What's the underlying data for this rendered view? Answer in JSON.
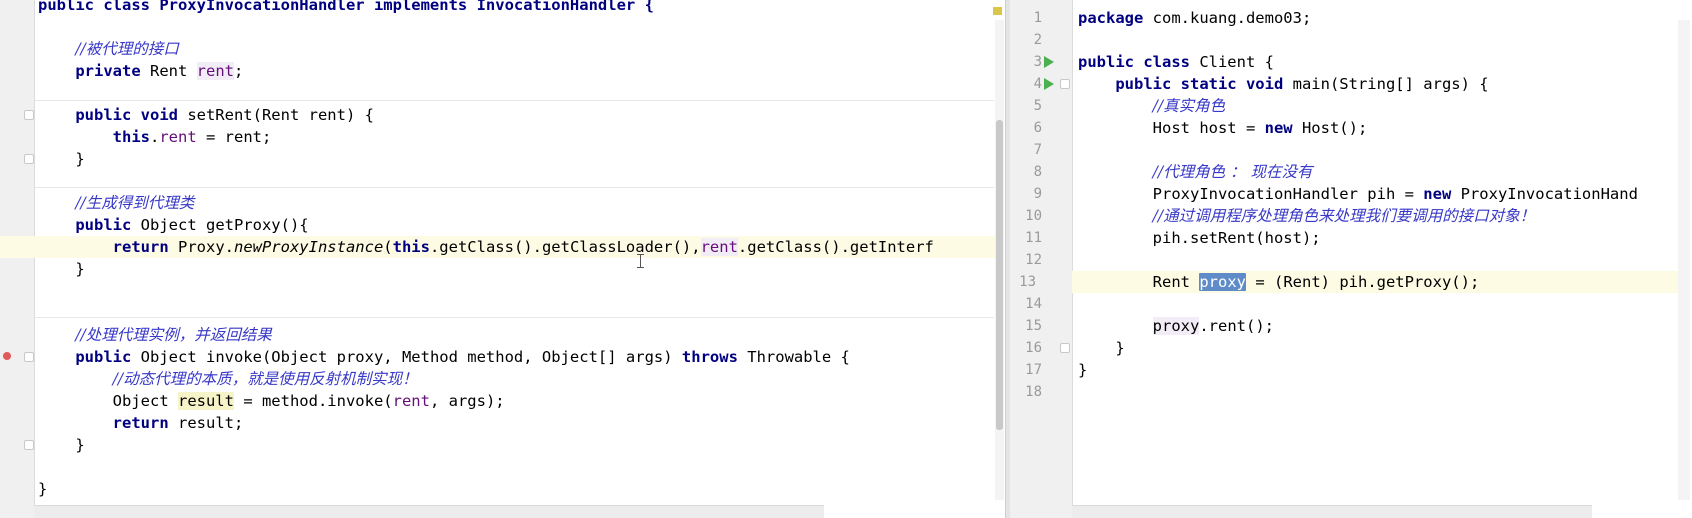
{
  "left_editor": {
    "lines": [
      {
        "segments": [
          {
            "t": "public class ProxyInvocationHandler implements InvocationHandler {",
            "c": "kw"
          }
        ]
      },
      {
        "segments": []
      },
      {
        "segments": [
          {
            "t": "    "
          },
          {
            "t": "//被代理的接口",
            "c": "cm"
          }
        ]
      },
      {
        "segments": [
          {
            "t": "    "
          },
          {
            "t": "private",
            "c": "kw"
          },
          {
            "t": " Rent "
          },
          {
            "t": "rent",
            "c": "fld use"
          },
          {
            "t": ";"
          }
        ]
      },
      {
        "segments": []
      },
      {
        "segments": [
          {
            "t": "    "
          },
          {
            "t": "public void",
            "c": "kw"
          },
          {
            "t": " setRent(Rent rent) {"
          }
        ]
      },
      {
        "segments": [
          {
            "t": "        "
          },
          {
            "t": "this",
            "c": "kw"
          },
          {
            "t": "."
          },
          {
            "t": "rent",
            "c": "fld"
          },
          {
            "t": " = rent;"
          }
        ]
      },
      {
        "segments": [
          {
            "t": "    }"
          }
        ]
      },
      {
        "segments": []
      },
      {
        "segments": [
          {
            "t": "    "
          },
          {
            "t": "//生成得到代理类",
            "c": "cm"
          }
        ]
      },
      {
        "segments": [
          {
            "t": "    "
          },
          {
            "t": "public",
            "c": "kw"
          },
          {
            "t": " Object getProxy(){"
          }
        ]
      },
      {
        "segments": [
          {
            "t": "        "
          },
          {
            "t": "return",
            "c": "kw"
          },
          {
            "t": " Proxy."
          },
          {
            "t": "newProxyInstance",
            "c": "it"
          },
          {
            "t": "("
          },
          {
            "t": "this",
            "c": "kw"
          },
          {
            "t": ".getClass().getClassLoader(),"
          },
          {
            "t": "rent",
            "c": "fld use"
          },
          {
            "t": ".getClass().getInterf"
          }
        ],
        "current": true
      },
      {
        "segments": [
          {
            "t": "    }"
          }
        ]
      },
      {
        "segments": []
      },
      {
        "segments": []
      },
      {
        "segments": [
          {
            "t": "    "
          },
          {
            "t": "//处理代理实例，并返回结果",
            "c": "cm"
          }
        ]
      },
      {
        "segments": [
          {
            "t": "    "
          },
          {
            "t": "public",
            "c": "kw"
          },
          {
            "t": " Object invoke(Object proxy, Method method, Object[] args) "
          },
          {
            "t": "throws",
            "c": "kw"
          },
          {
            "t": " Throwable {"
          }
        ]
      },
      {
        "segments": [
          {
            "t": "        "
          },
          {
            "t": "//动态代理的本质，就是使用反射机制实现！",
            "c": "cm"
          }
        ]
      },
      {
        "segments": [
          {
            "t": "        Object "
          },
          {
            "t": "result",
            "c": "res"
          },
          {
            "t": " = method.invoke("
          },
          {
            "t": "rent",
            "c": "fld"
          },
          {
            "t": ", args);"
          }
        ]
      },
      {
        "segments": [
          {
            "t": "        "
          },
          {
            "t": "return",
            "c": "kw"
          },
          {
            "t": " result;"
          }
        ]
      },
      {
        "segments": [
          {
            "t": "    }"
          }
        ]
      },
      {
        "segments": []
      },
      {
        "segments": [
          {
            "t": "}"
          }
        ]
      }
    ]
  },
  "right_editor": {
    "lines": [
      {
        "n": "1",
        "segments": [
          {
            "t": "package",
            "c": "kw"
          },
          {
            "t": " com.kuang.demo03;"
          }
        ]
      },
      {
        "n": "2",
        "segments": []
      },
      {
        "n": "3",
        "segments": [
          {
            "t": "public class",
            "c": "kw"
          },
          {
            "t": " Client {"
          }
        ],
        "run": true
      },
      {
        "n": "4",
        "segments": [
          {
            "t": "    "
          },
          {
            "t": "public static void",
            "c": "kw"
          },
          {
            "t": " main(String[] args) {"
          }
        ],
        "run": true
      },
      {
        "n": "5",
        "segments": [
          {
            "t": "        "
          },
          {
            "t": "//真实角色",
            "c": "cm"
          }
        ]
      },
      {
        "n": "6",
        "segments": [
          {
            "t": "        Host host = "
          },
          {
            "t": "new",
            "c": "kw"
          },
          {
            "t": " Host();"
          }
        ]
      },
      {
        "n": "7",
        "segments": []
      },
      {
        "n": "8",
        "segments": [
          {
            "t": "        "
          },
          {
            "t": "//代理角色 ： 现在没有",
            "c": "cm"
          }
        ]
      },
      {
        "n": "9",
        "segments": [
          {
            "t": "        ProxyInvocationHandler pih = "
          },
          {
            "t": "new",
            "c": "kw"
          },
          {
            "t": " ProxyInvocationHand"
          }
        ]
      },
      {
        "n": "10",
        "segments": [
          {
            "t": "        "
          },
          {
            "t": "//通过调用程序处理角色来处理我们要调用的接口对象！",
            "c": "cm"
          }
        ]
      },
      {
        "n": "11",
        "segments": [
          {
            "t": "        pih.setRent(host);"
          }
        ]
      },
      {
        "n": "12",
        "segments": []
      },
      {
        "n": "13",
        "segments": [
          {
            "t": "        Rent "
          },
          {
            "t": "proxy",
            "c": "sel"
          },
          {
            "t": " = (Rent) pih.getProxy();"
          }
        ],
        "current": true
      },
      {
        "n": "14",
        "segments": []
      },
      {
        "n": "15",
        "segments": [
          {
            "t": "        "
          },
          {
            "t": "proxy",
            "c": "use"
          },
          {
            "t": ".rent();"
          }
        ]
      },
      {
        "n": "16",
        "segments": [
          {
            "t": "    }"
          }
        ]
      },
      {
        "n": "17",
        "segments": [
          {
            "t": "}"
          }
        ]
      },
      {
        "n": "18",
        "segments": []
      }
    ]
  }
}
